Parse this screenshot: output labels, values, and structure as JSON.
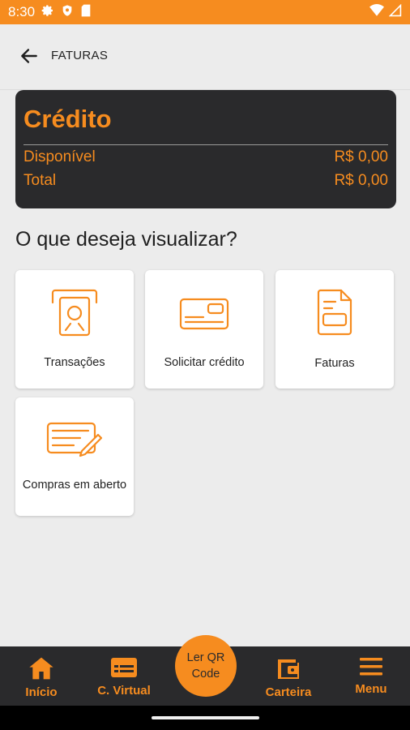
{
  "status_bar": {
    "time": "8:30",
    "colors": {
      "background": "#f68c1f"
    },
    "icons": [
      "settings-icon",
      "shield-icon",
      "sim-card-icon",
      "wifi-icon",
      "signal-icon"
    ]
  },
  "header": {
    "title": "FATURAS",
    "back_icon": "arrow-left-icon"
  },
  "credit": {
    "title": "Crédito",
    "rows": [
      {
        "label": "Disponível",
        "value": "R$ 0,00"
      },
      {
        "label": "Total",
        "value": "R$ 0,00"
      }
    ],
    "colors": {
      "background": "#2a2a2c",
      "accent": "#f68c1f"
    }
  },
  "main": {
    "question": "O que deseja visualizar?",
    "options": [
      {
        "label": "Transações",
        "icon": "atm-withdraw-icon"
      },
      {
        "label": "Solicitar crédito",
        "icon": "credit-card-icon"
      },
      {
        "label": "Faturas",
        "icon": "invoice-document-icon"
      },
      {
        "label": "Compras em aberto",
        "icon": "check-edit-icon"
      }
    ]
  },
  "bottom_nav": {
    "items": [
      {
        "label": "Início",
        "icon": "home-icon"
      },
      {
        "label": "C. Virtual",
        "icon": "virtual-card-icon"
      },
      {
        "label": "Carteira",
        "icon": "wallet-icon"
      },
      {
        "label": "Menu",
        "icon": "hamburger-menu-icon"
      }
    ],
    "qr_button": {
      "label": "Ler QR\nCode"
    },
    "colors": {
      "background": "#2a2a2c",
      "accent": "#f68c1f"
    }
  }
}
